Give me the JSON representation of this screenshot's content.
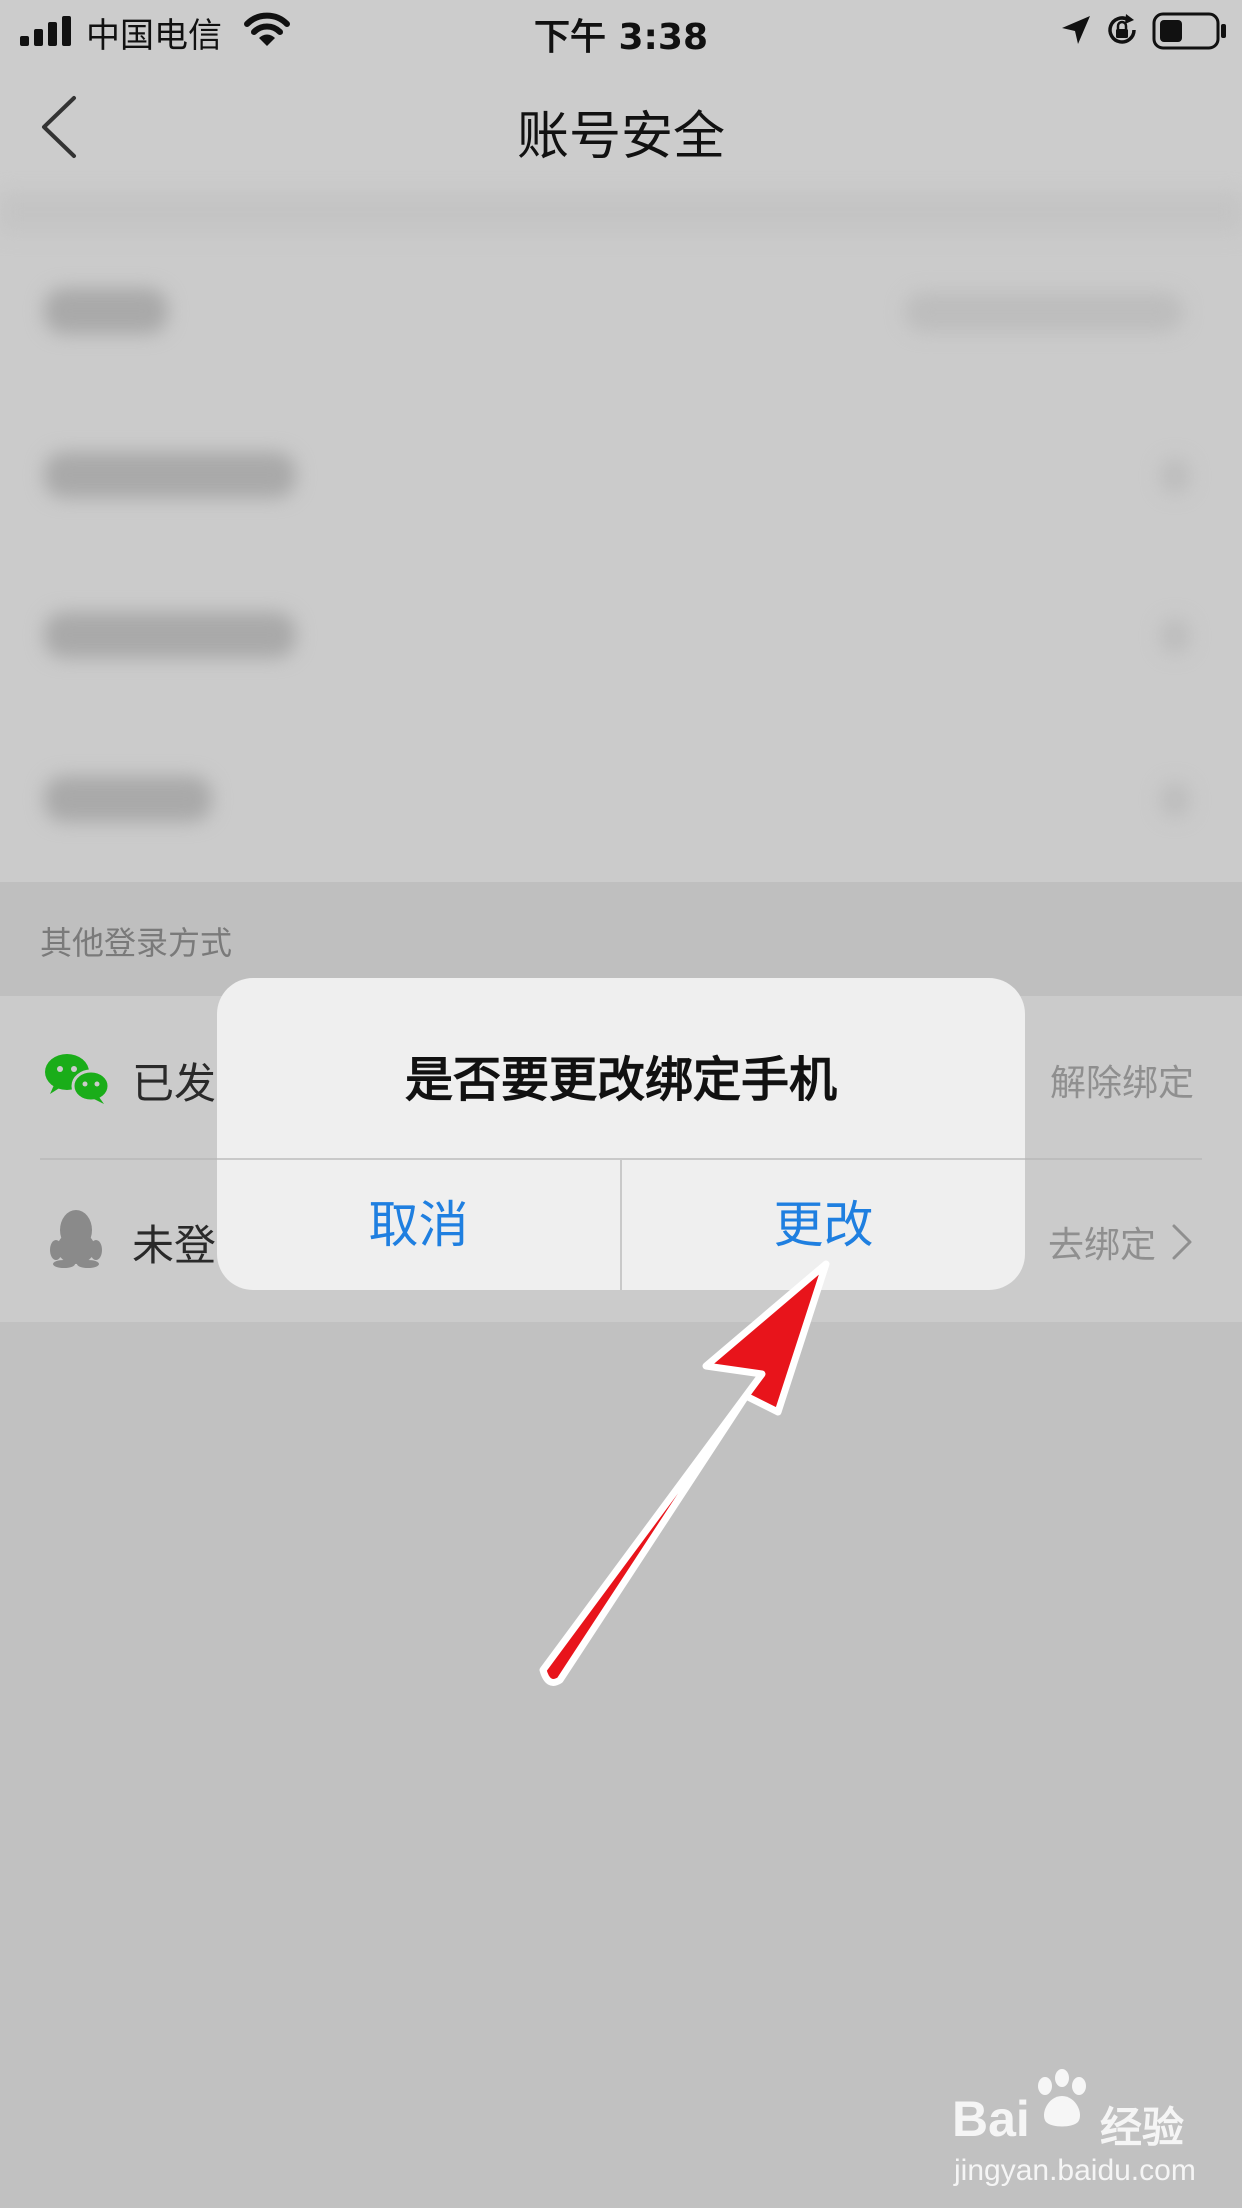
{
  "status_bar": {
    "carrier": "中国电信",
    "time": "下午 3:38"
  },
  "nav": {
    "title": "账号安全"
  },
  "group": {
    "header": "其他登录方式"
  },
  "login_rows": [
    {
      "label": "已发",
      "action": "解除绑定",
      "icon": "wechat-icon"
    },
    {
      "label": "未登",
      "action": "去绑定",
      "icon": "qq-icon"
    }
  ],
  "dialog": {
    "title": "是否要更改绑定手机",
    "cancel_label": "取消",
    "confirm_label": "更改"
  },
  "watermark": {
    "brand_left": "Bai",
    "brand_right": "经验",
    "url": "jingyan.baidu.com"
  },
  "colors": {
    "accent_blue": "#1f7fe0",
    "wechat_green": "#1aad19",
    "annotation_red": "#e8141b",
    "dim_background": "#c1c1c1"
  }
}
